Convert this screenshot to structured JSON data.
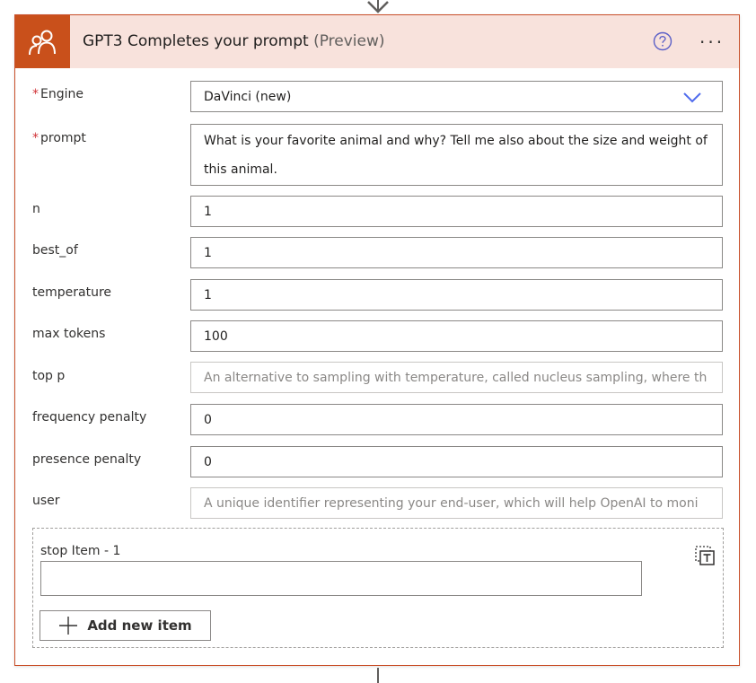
{
  "header": {
    "title": "GPT3 Completes your prompt",
    "preview": "(Preview)",
    "icons": {
      "app": "people-icon",
      "help": "help-circle-icon",
      "more": "more-horizontal-icon"
    },
    "more_glyph": "···",
    "accent_color": "#c9501b",
    "header_bg": "#f8e2dc"
  },
  "required_marker": "*",
  "fields": {
    "engine": {
      "label": "Engine",
      "value": "DaVinci (new)"
    },
    "prompt": {
      "label": "prompt",
      "value": "What is your favorite animal and why? Tell me also about the size and weight of this animal."
    },
    "n": {
      "label": "n",
      "value": "1"
    },
    "best_of": {
      "label": "best_of",
      "value": "1"
    },
    "temperature": {
      "label": "temperature",
      "value": "1"
    },
    "max_tokens": {
      "label": "max tokens",
      "value": "100"
    },
    "top_p": {
      "label": "top p",
      "value": "",
      "placeholder": "An alternative to sampling with temperature, called nucleus sampling, where th"
    },
    "frequency_penalty": {
      "label": "frequency penalty",
      "value": "0"
    },
    "presence_penalty": {
      "label": "presence penalty",
      "value": "0"
    },
    "user": {
      "label": "user",
      "value": "",
      "placeholder": "A unique identifier representing your end-user, which will help OpenAI to moni"
    }
  },
  "stop": {
    "item_label": "stop Item - 1",
    "value": "",
    "add_button_label": "Add new item",
    "icons": {
      "switch": "switch-to-text-icon",
      "add": "plus-icon"
    }
  }
}
